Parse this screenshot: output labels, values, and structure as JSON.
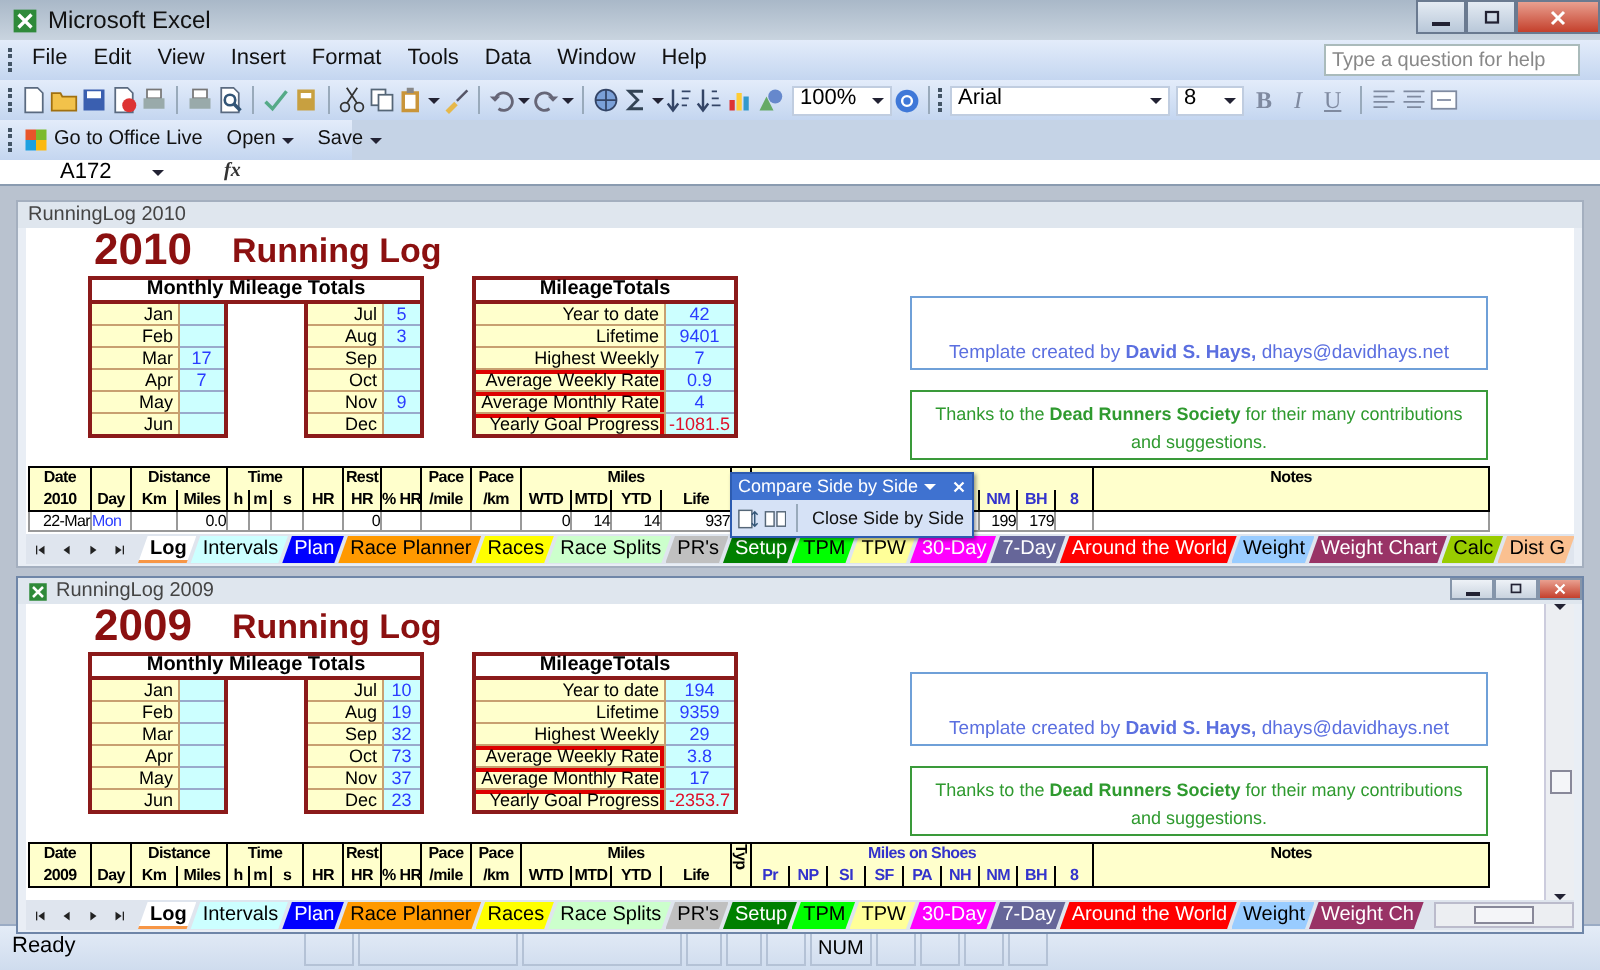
{
  "window": {
    "title": "Microsoft Excel"
  },
  "menu": [
    "File",
    "Edit",
    "View",
    "Insert",
    "Format",
    "Tools",
    "Data",
    "Window",
    "Help"
  ],
  "help_box": {
    "placeholder": "Type a question for help"
  },
  "standard_toolbar": {
    "zoom": "100%"
  },
  "formatting_toolbar": {
    "font": "Arial",
    "size": "8",
    "buttons": [
      "B",
      "I",
      "U"
    ]
  },
  "office_live_toolbar": {
    "buttons": [
      {
        "label": "Go to Office Live",
        "kind": "link"
      },
      {
        "label": "Open",
        "kind": "menu"
      },
      {
        "label": "Save",
        "kind": "menu"
      }
    ]
  },
  "formula_bar": {
    "name_box": "A172",
    "function_label": "fx"
  },
  "workbooks": [
    {
      "title": "RunningLog 2010",
      "active": false,
      "year": "2010",
      "heading": "Running Log",
      "monthly": {
        "title": "Monthly Mileage Totals",
        "months": [
          {
            "label": "Jan"
          },
          {
            "label": "Feb"
          },
          {
            "label": "Mar",
            "value": "17"
          },
          {
            "label": "Apr",
            "value": "7"
          },
          {
            "label": "May"
          },
          {
            "label": "Jun"
          },
          {
            "label": "Jul",
            "value": "5"
          },
          {
            "label": "Aug",
            "value": "3"
          },
          {
            "label": "Sep"
          },
          {
            "label": "Oct"
          },
          {
            "label": "Nov",
            "value": "9"
          },
          {
            "label": "Dec"
          }
        ]
      },
      "totals": {
        "title": "MileageTotals",
        "rows": [
          {
            "label": "Year to date",
            "value": "42",
            "comment": false,
            "negative": false
          },
          {
            "label": "Lifetime",
            "value": "9401",
            "comment": false,
            "negative": false
          },
          {
            "label": "Highest Weekly",
            "value": "7",
            "comment": false,
            "negative": false
          },
          {
            "label": "Average Weekly Rate",
            "value": "0.9",
            "comment": true,
            "negative": false
          },
          {
            "label": "Average Monthly Rate",
            "value": "4",
            "comment": true,
            "negative": false
          },
          {
            "label": "Yearly Goal Progress",
            "value": "-1081.5",
            "comment": true,
            "negative": true
          }
        ]
      },
      "credit": "Template created by **David S. Hays,** dhays@davidhays.net",
      "thanks": "Thanks to the **Dead Runners Society** for their many contributions and suggestions.",
      "log": {
        "header_top": {
          "date": "Date",
          "distance": "Distance",
          "time": "Time",
          "rest_hr": "Rest",
          "pace_mile": "Pace",
          "pace_km": "Pace",
          "miles": "Miles",
          "notes": "Notes"
        },
        "header_bottom": {
          "date": "2010",
          "day": "Day",
          "km": "Km",
          "miles": "Miles",
          "h": "h",
          "m": "m",
          "s": "s",
          "hr": "HR",
          "rest_hr": "HR",
          "pct_hr": "% HR",
          "pace_mile": "/mile",
          "pace_km": "/km",
          "wtd": "WTD",
          "mtd": "MTD",
          "ytd": "YTD",
          "life": "Life",
          "shoe_7": "NM",
          "shoe_8": "BH",
          "shoe_9": "8"
        },
        "rows": [
          {
            "date": "22-Mar",
            "day": "Mon",
            "miles": "0.0",
            "rest_hr": "0",
            "wtd": "0",
            "mtd": "14",
            "ytd": "14",
            "life": "937",
            "shoe_7": "199",
            "shoe_8": "179"
          }
        ]
      },
      "tabs": [
        {
          "label": "Log",
          "color": "#f79646",
          "selected": true
        },
        {
          "label": "Intervals",
          "color": "#ccffff",
          "selected": false
        },
        {
          "label": "Plan",
          "color": "#0000ff",
          "selected": false
        },
        {
          "label": "Race Planner",
          "color": "#ff9900",
          "selected": false
        },
        {
          "label": "Races",
          "color": "#ffff00",
          "selected": false
        },
        {
          "label": "Race Splits",
          "color": "#ccffcc",
          "selected": false
        },
        {
          "label": "PR's",
          "color": "#c0c0c0",
          "selected": false
        },
        {
          "label": "Setup",
          "color": "#008000",
          "selected": false
        },
        {
          "label": "TPM",
          "color": "#00ff00",
          "selected": false
        },
        {
          "label": "TPW",
          "color": "#ffff99",
          "selected": false
        },
        {
          "label": "30-Day",
          "color": "#ff00ff",
          "selected": false
        },
        {
          "label": "7-Day",
          "color": "#666699",
          "selected": false
        },
        {
          "label": "Around the World",
          "color": "#ff0000",
          "selected": false
        },
        {
          "label": "Weight",
          "color": "#99ccff",
          "selected": false
        },
        {
          "label": "Weight Chart",
          "color": "#993366",
          "selected": false
        },
        {
          "label": "Calc",
          "color": "#99cc00",
          "selected": false
        },
        {
          "label": "Dist G",
          "color": "#fac090",
          "selected": false
        }
      ]
    },
    {
      "title": "RunningLog 2009",
      "active": true,
      "year": "2009",
      "heading": "Running Log",
      "monthly": {
        "title": "Monthly Mileage Totals",
        "months": [
          {
            "label": "Jan"
          },
          {
            "label": "Feb"
          },
          {
            "label": "Mar"
          },
          {
            "label": "Apr"
          },
          {
            "label": "May"
          },
          {
            "label": "Jun"
          },
          {
            "label": "Jul",
            "value": "10"
          },
          {
            "label": "Aug",
            "value": "19"
          },
          {
            "label": "Sep",
            "value": "32"
          },
          {
            "label": "Oct",
            "value": "73"
          },
          {
            "label": "Nov",
            "value": "37"
          },
          {
            "label": "Dec",
            "value": "23"
          }
        ]
      },
      "totals": {
        "title": "MileageTotals",
        "rows": [
          {
            "label": "Year to date",
            "value": "194",
            "comment": false,
            "negative": false
          },
          {
            "label": "Lifetime",
            "value": "9359",
            "comment": false,
            "negative": false
          },
          {
            "label": "Highest Weekly",
            "value": "29",
            "comment": false,
            "negative": false
          },
          {
            "label": "Average Weekly Rate",
            "value": "3.8",
            "comment": true,
            "negative": false
          },
          {
            "label": "Average Monthly Rate",
            "value": "17",
            "comment": true,
            "negative": false
          },
          {
            "label": "Yearly Goal Progress",
            "value": "-2353.7",
            "comment": true,
            "negative": true
          }
        ]
      },
      "credit": "Template created by **David S. Hays,** dhays@davidhays.net",
      "thanks": "Thanks to the **Dead Runners Society** for their many contributions and suggestions.",
      "log": {
        "header_top": {
          "date": "Date",
          "distance": "Distance",
          "time": "Time",
          "rest_hr": "Rest",
          "pace_mile": "Pace",
          "pace_km": "Pace",
          "miles": "Miles",
          "type": "Typ",
          "shoes": "Miles on Shoes",
          "notes": "Notes"
        },
        "header_bottom": {
          "date": "2009",
          "day": "Day",
          "km": "Km",
          "miles": "Miles",
          "h": "h",
          "m": "m",
          "s": "s",
          "hr": "HR",
          "rest_hr": "HR",
          "pct_hr": "% HR",
          "pace_mile": "/mile",
          "pace_km": "/km",
          "wtd": "WTD",
          "mtd": "MTD",
          "ytd": "YTD",
          "life": "Life",
          "shoe_1": "Pr",
          "shoe_2": "NP",
          "shoe_3": "SI",
          "shoe_4": "SF",
          "shoe_5": "PA",
          "shoe_6": "NH",
          "shoe_7": "NM",
          "shoe_8": "BH",
          "shoe_9": "8"
        }
      },
      "tabs": [
        {
          "label": "Log",
          "color": "#f79646",
          "selected": true
        },
        {
          "label": "Intervals",
          "color": "#ccffff",
          "selected": false
        },
        {
          "label": "Plan",
          "color": "#0000ff",
          "selected": false
        },
        {
          "label": "Race Planner",
          "color": "#ff9900",
          "selected": false
        },
        {
          "label": "Races",
          "color": "#ffff00",
          "selected": false
        },
        {
          "label": "Race Splits",
          "color": "#ccffcc",
          "selected": false
        },
        {
          "label": "PR's",
          "color": "#c0c0c0",
          "selected": false
        },
        {
          "label": "Setup",
          "color": "#008000",
          "selected": false
        },
        {
          "label": "TPM",
          "color": "#00ff00",
          "selected": false
        },
        {
          "label": "TPW",
          "color": "#ffff99",
          "selected": false
        },
        {
          "label": "30-Day",
          "color": "#ff00ff",
          "selected": false
        },
        {
          "label": "7-Day",
          "color": "#666699",
          "selected": false
        },
        {
          "label": "Around the World",
          "color": "#ff0000",
          "selected": false
        },
        {
          "label": "Weight",
          "color": "#99ccff",
          "selected": false
        },
        {
          "label": "Weight Ch",
          "color": "#993366",
          "selected": false
        }
      ]
    }
  ],
  "compare_toolbar": {
    "title": "Compare Side by Side",
    "close_button": "Close Side by Side"
  },
  "status_bar": {
    "status": "Ready",
    "indicators": [
      "NUM"
    ]
  }
}
